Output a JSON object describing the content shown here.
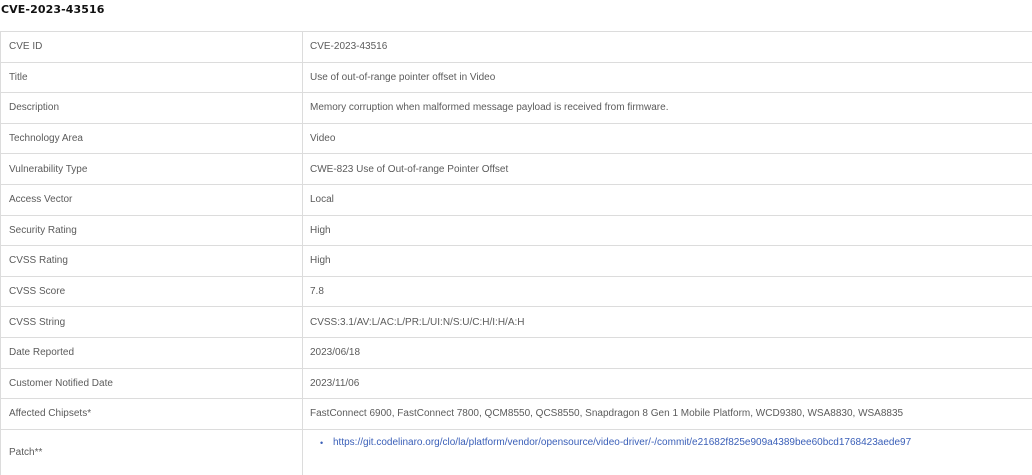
{
  "page": {
    "title": "CVE-2023-43516"
  },
  "table": {
    "rows": [
      {
        "label": "CVE ID",
        "value": "CVE-2023-43516"
      },
      {
        "label": "Title",
        "value": "Use of out-of-range pointer offset in Video"
      },
      {
        "label": "Description",
        "value": "Memory corruption when malformed message payload is received from firmware."
      },
      {
        "label": "Technology Area",
        "value": "Video"
      },
      {
        "label": "Vulnerability Type",
        "value": "CWE-823 Use of Out-of-range Pointer Offset"
      },
      {
        "label": "Access Vector",
        "value": "Local"
      },
      {
        "label": "Security Rating",
        "value": "High"
      },
      {
        "label": "CVSS Rating",
        "value": "High"
      },
      {
        "label": "CVSS Score",
        "value": "7.8"
      },
      {
        "label": "CVSS String",
        "value": "CVSS:3.1/AV:L/AC:L/PR:L/UI:N/S:U/C:H/I:H/A:H"
      },
      {
        "label": "Date Reported",
        "value": "2023/06/18"
      },
      {
        "label": "Customer Notified Date",
        "value": "2023/11/06"
      },
      {
        "label": "Affected Chipsets*",
        "value": "FastConnect 6900, FastConnect 7800, QCM8550, QCS8550, Snapdragon 8 Gen 1 Mobile Platform, WCD9380, WSA8830, WSA8835"
      }
    ],
    "patch": {
      "label": "Patch**",
      "links": [
        "https://git.codelinaro.org/clo/la/platform/vendor/opensource/video-driver/-/commit/e21682f825e909a4389bee60bcd1768423aede97"
      ]
    }
  },
  "colors": {
    "border": "#dcdcdc",
    "text": "#5b5b5b",
    "title": "#111111",
    "link": "#3a5fb8"
  }
}
